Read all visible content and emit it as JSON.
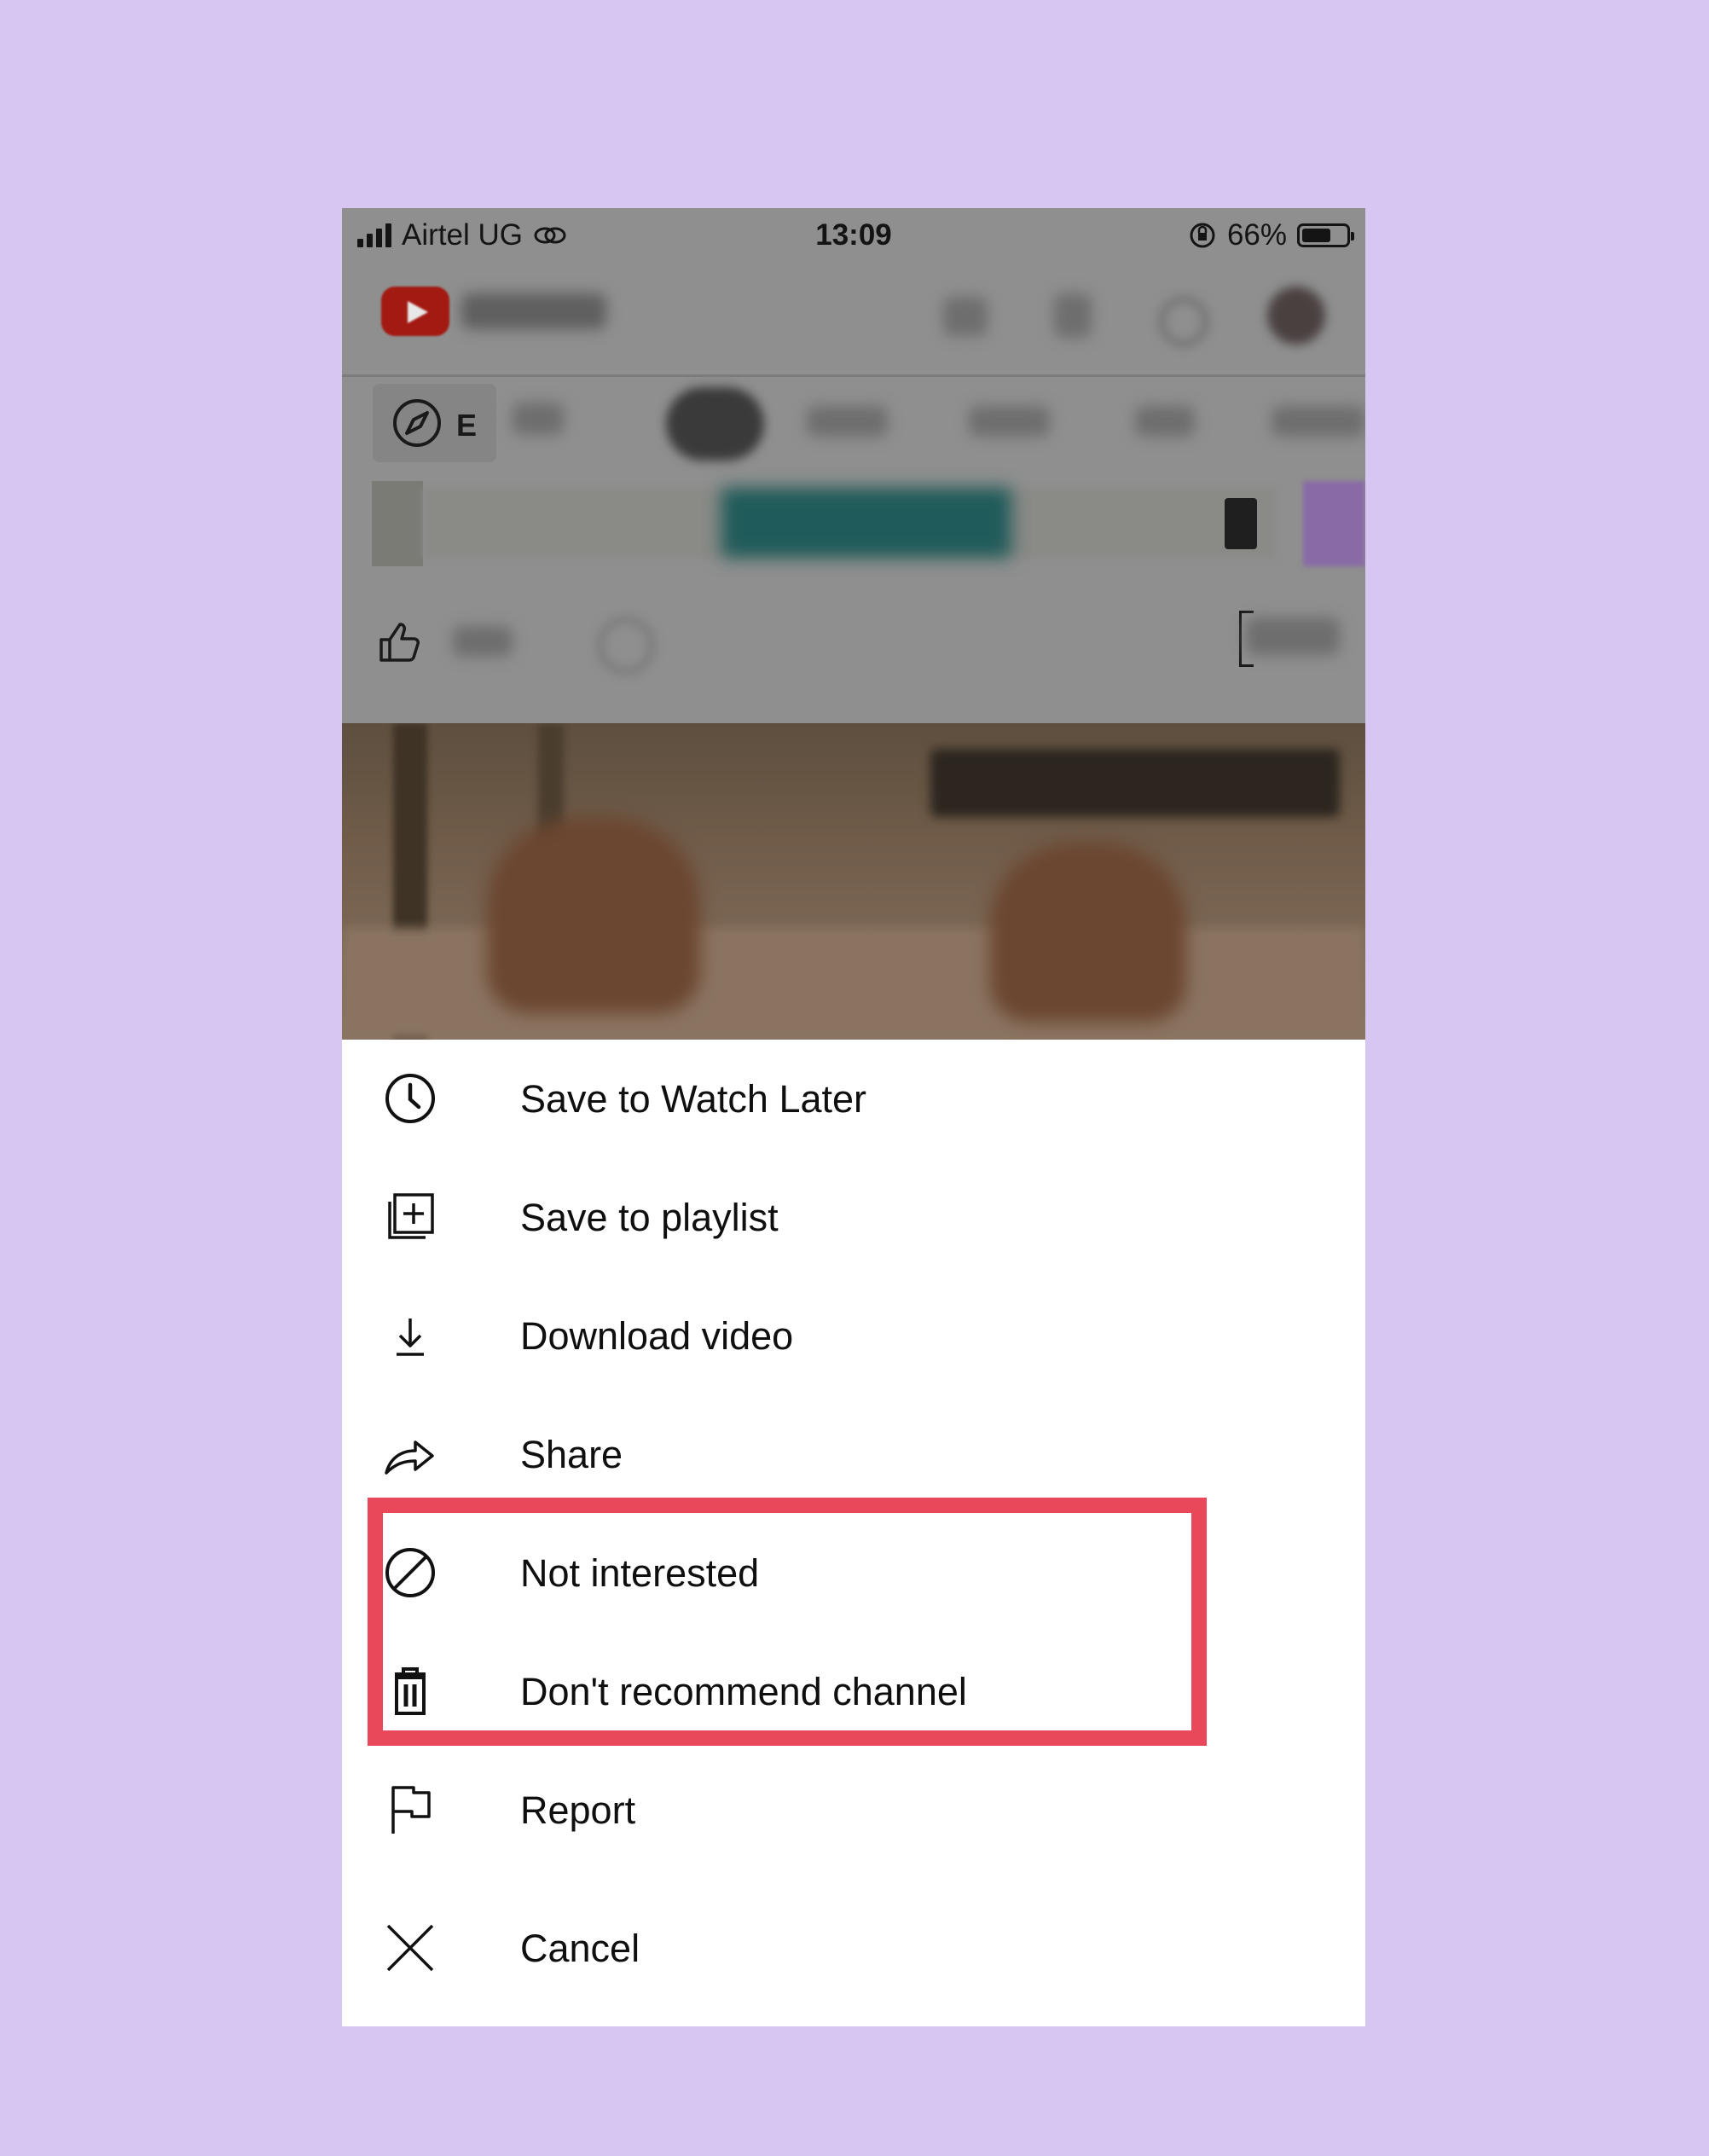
{
  "status_bar": {
    "carrier": "Airtel UG",
    "time": "13:09",
    "battery_percent": "66%",
    "battery_level": 0.66,
    "icons": [
      "signal-icon",
      "hotspot-icon",
      "orientation-lock-icon",
      "battery-icon"
    ]
  },
  "background": {
    "explore_label": "E"
  },
  "menu": {
    "items": [
      {
        "label": "Save to Watch Later",
        "icon": "clock-icon"
      },
      {
        "label": "Save to playlist",
        "icon": "playlist-add-icon"
      },
      {
        "label": "Download video",
        "icon": "download-icon"
      },
      {
        "label": "Share",
        "icon": "share-icon"
      },
      {
        "label": "Not interested",
        "icon": "block-icon"
      },
      {
        "label": "Don't recommend channel",
        "icon": "trash-icon"
      },
      {
        "label": "Report",
        "icon": "flag-icon"
      }
    ],
    "cancel": {
      "label": "Cancel",
      "icon": "close-icon"
    }
  },
  "colors": {
    "page_background": "#d7c6f2",
    "highlight_border": "#e8485a",
    "sheet_background": "#ffffff",
    "text": "#0f0f0f"
  }
}
